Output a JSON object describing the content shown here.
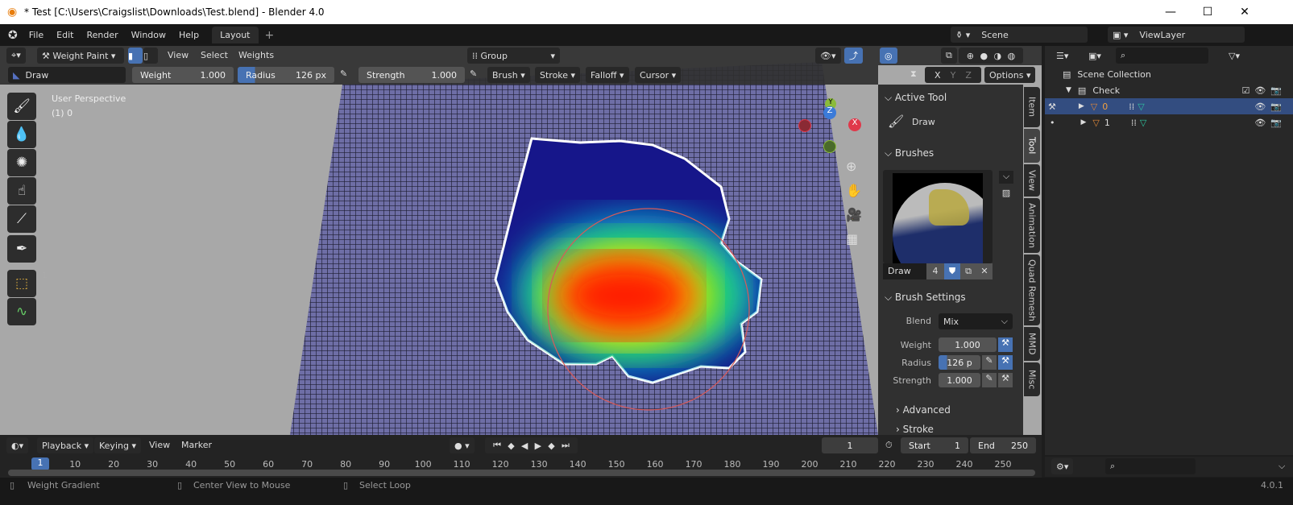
{
  "window": {
    "title": "* Test [C:\\Users\\Craigslist\\Downloads\\Test.blend] - Blender 4.0",
    "minimize": "—",
    "maximize": "☐",
    "close": "✕"
  },
  "menu": {
    "items": [
      "File",
      "Edit",
      "Render",
      "Window",
      "Help"
    ],
    "workspace_tab": "Layout",
    "add_tab": "+"
  },
  "scene": {
    "name": "Scene",
    "view_layer": "ViewLayer"
  },
  "viewport_header": {
    "mode": "Weight Paint",
    "view": "View",
    "select": "Select",
    "weights": "Weights",
    "vertex_group": "Group"
  },
  "tool_header": {
    "brush": "Draw",
    "weight_label": "Weight",
    "weight": "1.000",
    "radius_label": "Radius",
    "radius": "126 px",
    "strength_label": "Strength",
    "strength": "1.000",
    "menus": [
      "Brush",
      "Stroke",
      "Falloff",
      "Cursor"
    ],
    "axes": [
      "X",
      "Y",
      "Z"
    ],
    "options": "Options"
  },
  "viewport": {
    "perspective": "User Perspective",
    "object": "(1) 0",
    "toolbar_index": "1",
    "gizmo": {
      "x": "X",
      "y": "Y",
      "z": "Z"
    },
    "colors": {
      "mesh": "#6e6ea6",
      "zero_weight": "#16168a",
      "full_weight": "#ff1a00",
      "brush_circle": "#d85a5a"
    }
  },
  "npanel": {
    "tabs": [
      "Item",
      "Tool",
      "View",
      "Animation",
      "Quad Remesh",
      "MMD",
      "Misc"
    ],
    "active_tool": {
      "title": "Active Tool",
      "name": "Draw"
    },
    "brushes": {
      "title": "Brushes",
      "name": "Draw",
      "users": "4"
    },
    "brush_settings": {
      "title": "Brush Settings",
      "blend_label": "Blend",
      "blend": "Mix",
      "weight_label": "Weight",
      "weight": "1.000",
      "radius_label": "Radius",
      "radius": "126 p",
      "strength_label": "Strength",
      "strength": "1.000"
    },
    "advanced": "Advanced",
    "stroke": "Stroke"
  },
  "outliner": {
    "root": "Scene Collection",
    "collection": "Check",
    "objects": [
      {
        "name": "0",
        "selected": true
      },
      {
        "name": "1",
        "selected": false
      }
    ]
  },
  "timeline": {
    "menus": [
      "Playback",
      "Keying",
      "View",
      "Marker"
    ],
    "current_frame": "1",
    "start_label": "Start",
    "start": "1",
    "end_label": "End",
    "end": "250",
    "ticks": [
      "10",
      "20",
      "30",
      "40",
      "50",
      "60",
      "70",
      "80",
      "90",
      "100",
      "110",
      "120",
      "130",
      "140",
      "150",
      "160",
      "170",
      "180",
      "190",
      "200",
      "210",
      "220",
      "230",
      "240",
      "250"
    ],
    "playhead": "1"
  },
  "status": {
    "hints": [
      "Weight Gradient",
      "Center View to Mouse",
      "Select Loop"
    ],
    "version": "4.0.1"
  }
}
